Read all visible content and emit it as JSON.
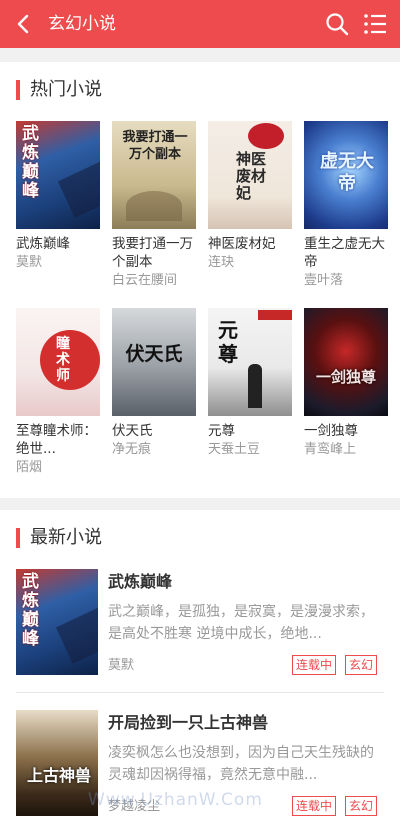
{
  "header": {
    "title": "玄幻小说",
    "bg_color": "#ee4b4e"
  },
  "hot": {
    "title": "热门小说",
    "books": [
      {
        "name": "武炼巅峰",
        "author": "莫默",
        "cover_text": "武炼巅峰",
        "cover_color": "#2f5fa6"
      },
      {
        "name": "我要打通一万个副本",
        "author": "白云在腰间",
        "cover_text": "我要打通一万个副本",
        "cover_color": "#c9b98e"
      },
      {
        "name": "神医废材妃",
        "author": "连玦",
        "cover_text": "神医废材妃",
        "cover_color": "#efe6da"
      },
      {
        "name": "重生之虚无大帝",
        "author": "壹叶落",
        "cover_text": "虚无大帝",
        "cover_color": "#2a4ea8"
      },
      {
        "name": "至尊瞳术师：绝世...",
        "author": "陌烟",
        "cover_text": "瞳术师",
        "cover_color": "#f3e6e6"
      },
      {
        "name": "伏天氏",
        "author": "净无痕",
        "cover_text": "伏天氏",
        "cover_color": "#9aa0a6"
      },
      {
        "name": "元尊",
        "author": "天蚕土豆",
        "cover_text": "元尊",
        "cover_color": "#e9e9e9"
      },
      {
        "name": "一剑独尊",
        "author": "青鸾峰上",
        "cover_text": "一剑独尊",
        "cover_color": "#1b1b2b"
      }
    ]
  },
  "latest": {
    "title": "最新小说",
    "items": [
      {
        "name": "武炼巅峰",
        "desc": "武之巅峰，是孤独，是寂寞，是漫漫求索，是高处不胜寒 逆境中成长，绝地...",
        "author": "莫默",
        "status": "连载中",
        "genre": "玄幻",
        "cover_text": "武炼巅峰"
      },
      {
        "name": "开局捡到一只上古神兽",
        "desc": "凌奕枫怎么也没想到，因为自己天生残缺的灵魂却因祸得福，竟然无意中融...",
        "author": "梦越凌尘",
        "status": "连载中",
        "genre": "玄幻",
        "cover_text": "上古神兽"
      }
    ]
  },
  "watermark": "Www.UzhanW.Com"
}
